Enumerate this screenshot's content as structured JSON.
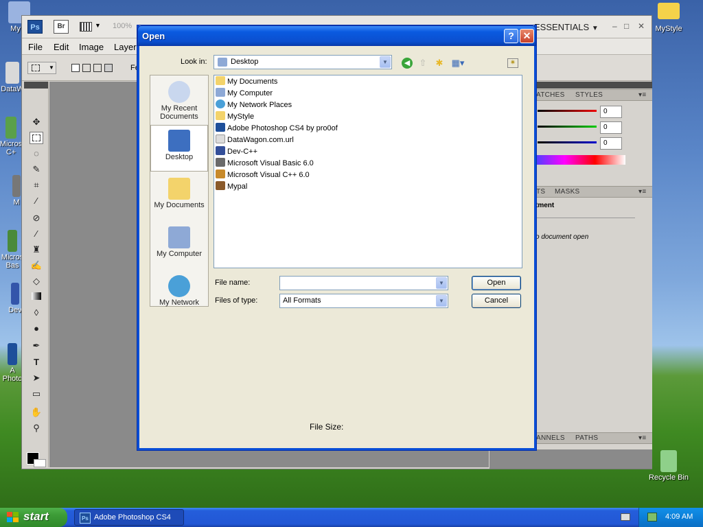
{
  "desktop": {
    "icons": [
      {
        "label": "My C",
        "color": "#9ab3e0"
      },
      {
        "label": "DataW",
        "color": "#d9d9d9"
      },
      {
        "label": "Micros",
        "label2": "C+",
        "color": "#5aa04a"
      },
      {
        "label": "M",
        "color": "#777777"
      },
      {
        "label": "Micros",
        "label2": "Bas",
        "color": "#4a8a3a"
      },
      {
        "label": "Dev",
        "color": "#3355aa"
      },
      {
        "label": "A",
        "label2": "Photo",
        "color": "#1e4f9a"
      },
      {
        "label": "MyStyle",
        "color": "#f5d24a"
      },
      {
        "label": "Recycle Bin",
        "color": "#8fd08a"
      }
    ]
  },
  "photoshop": {
    "logo": "Ps",
    "bridge": "Br",
    "zoom": "100%",
    "workspace": "ESSENTIALS",
    "menu": [
      "File",
      "Edit",
      "Image",
      "Layer"
    ],
    "options_partial": "Fe",
    "panel_tabs_1": [
      "ATCHES",
      "STYLES"
    ],
    "rgb_values": [
      "0",
      "0",
      "0"
    ],
    "panel_tabs_2": [
      "TS",
      "MASKS"
    ],
    "adjustments_title": "tment",
    "no_document": "o document open",
    "panel_tabs_3": [
      "ANNELS",
      "PATHS"
    ]
  },
  "dialog": {
    "title": "Open",
    "help": "?",
    "close": "✕",
    "look_in_label": "Look in:",
    "look_in_value": "Desktop",
    "places": [
      "My Recent Documents",
      "Desktop",
      "My Documents",
      "My Computer",
      "My Network"
    ],
    "files": [
      {
        "name": "My Documents",
        "icon": "folder-docs-icon",
        "color": "#f3d36b"
      },
      {
        "name": "My Computer",
        "icon": "computer-icon",
        "color": "#8ea9d6"
      },
      {
        "name": "My Network Places",
        "icon": "network-icon",
        "color": "#4aa0d8"
      },
      {
        "name": "MyStyle",
        "icon": "folder-icon",
        "color": "#f3d36b"
      },
      {
        "name": "Adobe Photoshop CS4 by pro0of",
        "icon": "photoshop-icon",
        "color": "#1e4f9a"
      },
      {
        "name": "DataWagon.com.url",
        "icon": "url-icon",
        "color": "#dcdcdc"
      },
      {
        "name": "Dev-C++",
        "icon": "devcpp-icon",
        "color": "#334f99"
      },
      {
        "name": "Microsoft Visual Basic 6.0",
        "icon": "vb-icon",
        "color": "#6a6a6a"
      },
      {
        "name": "Microsoft Visual C++ 6.0",
        "icon": "vcpp-icon",
        "color": "#c88a2a"
      },
      {
        "name": "Mypal",
        "icon": "mypal-icon",
        "color": "#8a5a2a"
      }
    ],
    "filename_label": "File name:",
    "filename_value": "",
    "filetype_label": "Files of type:",
    "filetype_value": "All Formats",
    "open_button": "Open",
    "cancel_button": "Cancel",
    "file_size_label": "File Size:"
  },
  "taskbar": {
    "start": "start",
    "task_title": "Adobe Photoshop CS4",
    "task_icon": "Ps",
    "clock": "4:09 AM"
  }
}
